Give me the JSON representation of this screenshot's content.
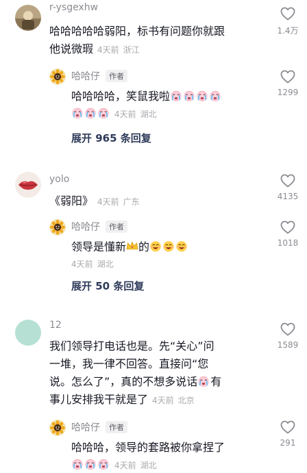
{
  "comments": [
    {
      "username": "r-ysgexhw",
      "text_line1": "哈哈哈哈哈弱阳，标书有问题你就跟",
      "text_line2": "他说微瑕",
      "time": "4天前",
      "location": "浙江",
      "likes": "1.4万",
      "reply": {
        "username": "哈哈仔",
        "tag": "作者",
        "text_line1": "哈哈哈哈，笑鼠我啦",
        "time": "4天前",
        "location": "湖北",
        "likes": "1299"
      },
      "expand": "展开 965 条回复"
    },
    {
      "username": "yolo",
      "text_line1": "《弱阳》",
      "time": "4天前",
      "location": "广东",
      "likes": "4135",
      "reply": {
        "username": "哈哈仔",
        "tag": "作者",
        "text_part1": "领导是懂新",
        "text_part2": "的",
        "time": "4天前",
        "location": "湖北",
        "likes": "1018"
      },
      "expand": "展开 50 条回复"
    },
    {
      "username": "12",
      "text_line1": "我们领导打电话也是。先“关心”问",
      "text_line2": "一堆，我一律不回答。直接问“您",
      "text_line3": "说。怎么了”，真的不想多说话",
      "text_line3b": "有",
      "text_line4": "事儿安排我干就是了",
      "time": "4天前",
      "location": "北京",
      "likes": "1589",
      "reply": {
        "username": "哈哈仔",
        "tag": "作者",
        "text_line1": "哈哈哈，领导的套路被你拿捏了",
        "time": "4天前",
        "location": "湖北",
        "likes": "291"
      }
    }
  ],
  "colors": {
    "text": "#161823",
    "muted": "#a8a9ad",
    "username": "#8a8b91",
    "expand": "#2e3a59"
  }
}
